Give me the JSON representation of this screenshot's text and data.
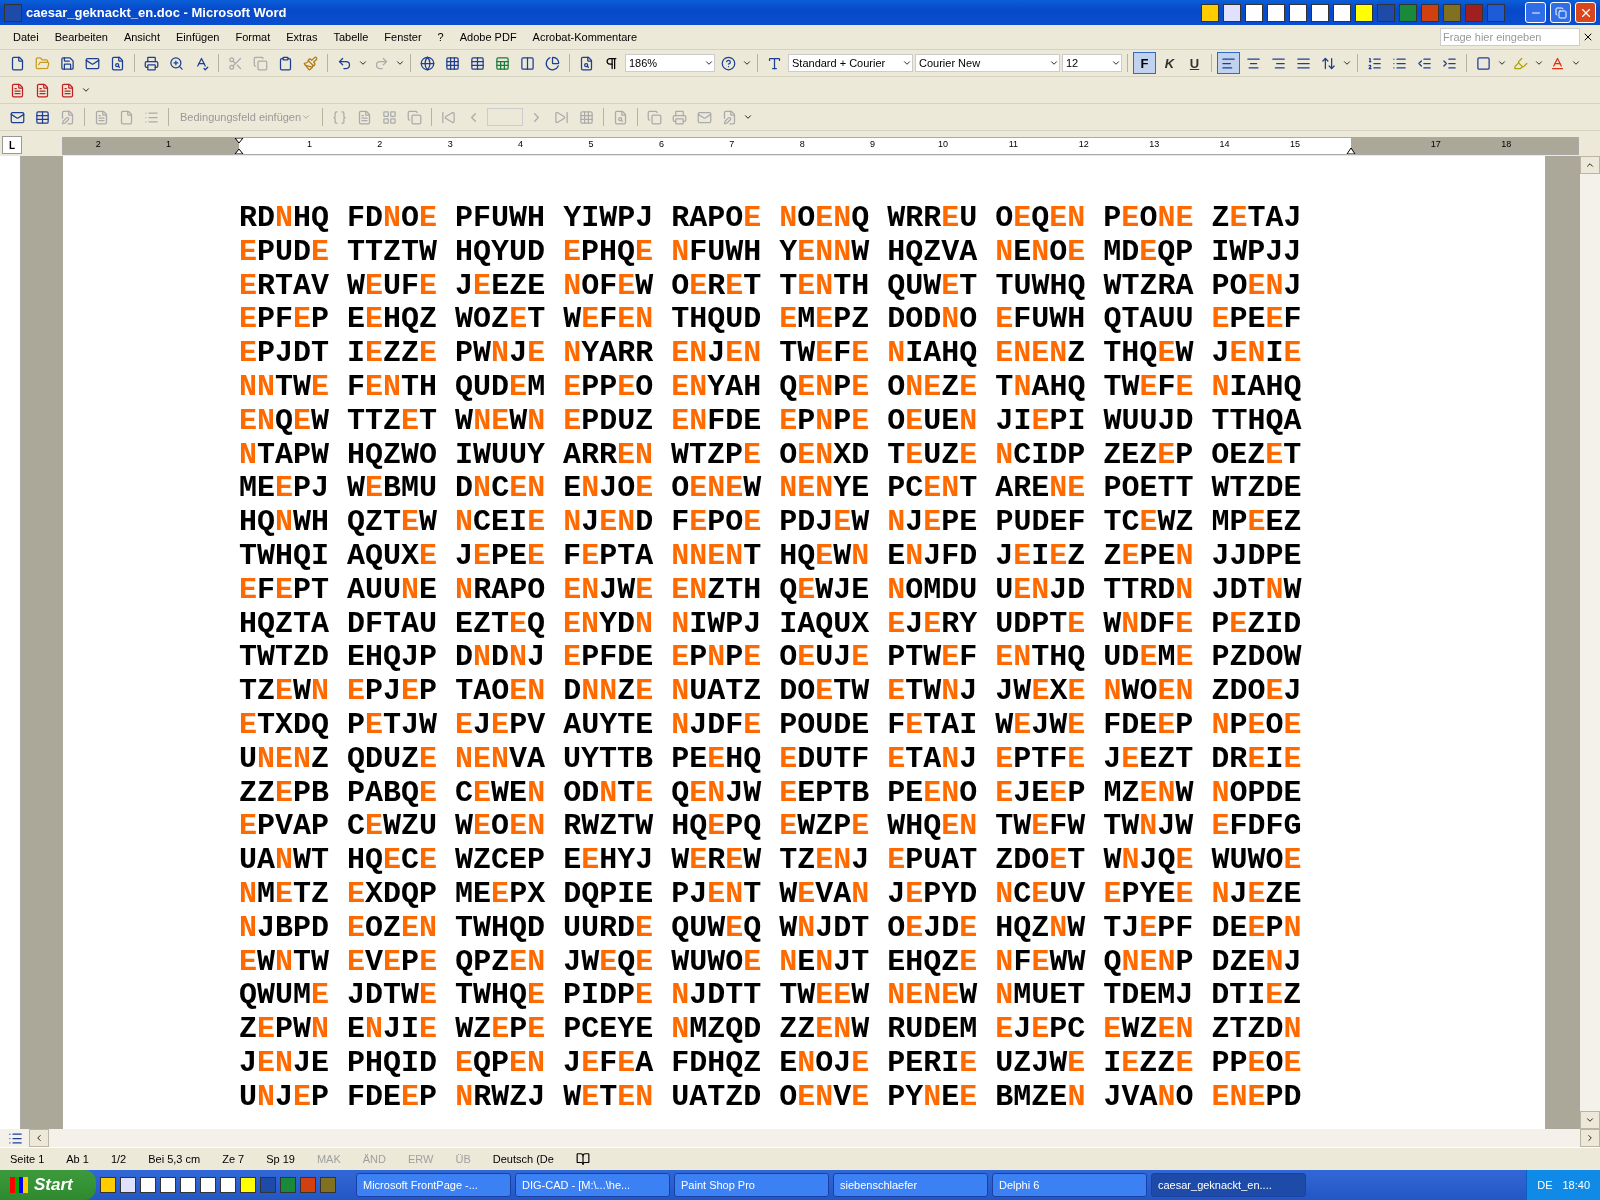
{
  "window": {
    "title": "caesar_geknackt_en.doc - Microsoft Word"
  },
  "menu": [
    "Datei",
    "Bearbeiten",
    "Ansicht",
    "Einfügen",
    "Format",
    "Extras",
    "Tabelle",
    "Fenster",
    "?",
    "Adobe PDF",
    "Acrobat-Kommentare"
  ],
  "help_box": {
    "placeholder": "Frage hier eingeben"
  },
  "formatting": {
    "zoom": "186%",
    "style": "Standard + Courier",
    "font": "Courier New",
    "size": "12",
    "bold": {
      "label": "F",
      "selected": true
    },
    "italic": {
      "label": "K",
      "selected": false
    },
    "underline": {
      "label": "U",
      "selected": false
    },
    "align_left_selected": true
  },
  "mail_merge": {
    "field_button": {
      "label": "Bedingungsfeld einfügen",
      "disabled": true
    }
  },
  "ruler": {
    "tab_selector": "L",
    "left_numbers": [
      "2",
      "1"
    ],
    "numbers": [
      "1",
      "2",
      "3",
      "4",
      "5",
      "6",
      "7",
      "8",
      "9",
      "10",
      "11",
      "12",
      "13",
      "14",
      "15",
      "17",
      "18"
    ]
  },
  "document": {
    "lines": [
      [
        "RD**N**HQ",
        "FD**N**O**E**",
        "PFUWH",
        "YIWPJ",
        "RAPO**E**",
        "**N**O**EN**Q",
        "WRR**E**U",
        "O**E**Q**EN**",
        "P**E**O**NE**",
        "Z**E**TAJ"
      ],
      [
        "**E**PUD**E**",
        "TTZTW",
        "HQYUD",
        "**E**PHQ**E**",
        "**N**FUWH",
        "Y**ENN**W",
        "HQZVA",
        "**N**E**N**O**E**",
        "MD**E**QP",
        "IWPJJ"
      ],
      [
        "**E**RTAV",
        "W**E**UF**E**",
        "J**E**EZE",
        "**N**OF**E**W",
        "O**E**R**E**T",
        "T**EN**TH",
        "QUW**E**T",
        "TUWHQ",
        "WTZRA",
        "PO**EN**J"
      ],
      [
        "**E**PF**E**P",
        "E**E**HQZ",
        "WOZ**E**T",
        "W**E**F**EN**",
        "THQUD",
        "**E**M**E**PZ",
        "DOD**N**O",
        "**E**FUWH",
        "QTAUU",
        "**E**PE**E**F"
      ],
      [
        "**E**PJDT",
        "I**E**ZZ**E**",
        "PW**N**J**E**",
        "**N**YARR",
        "**EN**J**EN**",
        "TW**E**F**E**",
        "**N**IAHQ",
        "**ENEN**Z",
        "THQ**E**W",
        "J**EN**I**E**"
      ],
      [
        "**NN**TW**E**",
        "F**EN**TH",
        "QUD**E**M",
        "**E**PP**E**O",
        "**EN**YAH",
        "Q**EN**P**E**",
        "O**NE**Z**E**",
        "T**N**AHQ",
        "TW**E**F**E**",
        "**N**IAHQ"
      ],
      [
        "**EN**Q**E**W",
        "TTZ**E**T",
        "W**NE**W**N**",
        "**E**PDUZ",
        "**EN**FDE",
        "**E**P**N**P**E**",
        "O**E**UE**N**",
        "JI**E**PI",
        "WUUJD",
        "TTHQA"
      ],
      [
        "**N**TAPW",
        "HQZWO",
        "IWUUY",
        "ARR**EN**",
        "WTZP**E**",
        "O**EN**XD",
        "T**E**UZ**E**",
        "**N**CIDP",
        "ZEZ**E**P",
        "OEZ**E**T"
      ],
      [
        "ME**E**PJ",
        "W**E**BMU",
        "D**N**C**EN**",
        "E**N**JO**E**",
        "O**ENE**W",
        "**NEN**YE",
        "PC**EN**T",
        "ARE**NE**",
        "POETT",
        "WTZDE"
      ],
      [
        "HQ**N**WH",
        "QZT**E**W",
        "**N**CEI**E**",
        "**N**J**EN**D",
        "F**E**PO**E**",
        "PDJ**E**W",
        "**N**J**E**PE",
        "PUDEF",
        "TC**E**WZ",
        "MP**E**EZ"
      ],
      [
        "TWHQI",
        "AQUX**E**",
        "J**E**PE**E**",
        "F**E**PTA",
        "**NNEN**T",
        "HQ**E**W**N**",
        "E**N**JFD",
        "J**E**I**E**Z",
        "Z**E**PE**N**",
        "JJDPE"
      ],
      [
        "**E**F**E**PT",
        "AUU**N**E",
        "**N**RAPO",
        "**EN**JW**E**",
        "**EN**ZTH",
        "Q**E**WJE",
        "**N**OMDU",
        "U**EN**JD",
        "TTRD**N**",
        "JDT**N**W"
      ],
      [
        "HQZTA",
        "DFTAU",
        "EZT**E**Q",
        "**EN**YD**N**",
        "**N**IWPJ",
        "IAQUX",
        "**E**J**E**RY",
        "UDPT**E**",
        "W**N**DF**E**",
        "P**E**ZID"
      ],
      [
        "TWTZD",
        "EHQJP",
        "D**N**D**N**J",
        "**E**PFDE",
        "**E**P**N**P**E**",
        "O**E**UJ**E**",
        "PTW**E**F",
        "**EN**THQ",
        "UD**E**M**E**",
        "PZDOW"
      ],
      [
        "TZ**E**W**N**",
        "**E**PJ**E**P",
        "TAO**EN**",
        "D**NN**Z**E**",
        "**N**UATZ",
        "DO**E**TW",
        "**E**TW**N**J",
        "JW**E**X**E**",
        "**N**WO**EN**",
        "ZDO**E**J"
      ],
      [
        "**E**TXDQ",
        "P**E**TJW",
        "**E**J**E**PV",
        "AUYTE",
        "**N**JDF**E**",
        "POUDE",
        "F**E**TAI",
        "W**E**JW**E**",
        "FDE**E**P",
        "**N**P**E**O**E**"
      ],
      [
        "U**NEN**Z",
        "QDUZ**E**",
        "**NEN**VA",
        "UYTTB",
        "PE**E**HQ",
        "**E**DUTF",
        "**E**TA**N**J",
        "**E**PTF**E**",
        "J**E**EZT",
        "DR**E**I**E**"
      ],
      [
        "ZZ**E**PB",
        "PABQ**E**",
        "C**E**WE**N**",
        "OD**N**T**E**",
        "Q**EN**JW",
        "**E**EPTB",
        "PE**EN**O",
        "**E**JE**E**P",
        "MZ**EN**W",
        "**N**OPDE"
      ],
      [
        "**E**PVAP",
        "C**E**WZU",
        "W**E**O**EN**",
        "RWZTW",
        "HQ**E**PQ",
        "**E**WZP**E**",
        "WHQ**EN**",
        "TW**E**FW",
        "TW**N**JW",
        "**E**FDFG"
      ],
      [
        "UA**N**WT",
        "HQ**E**C**E**",
        "WZCEP",
        "E**E**HYJ",
        "W**E**R**E**W",
        "TZ**EN**J",
        "**E**PUAT",
        "ZDO**E**T",
        "W**N**JQ**E**",
        "WUWO**E**"
      ],
      [
        "**N**M**E**TZ",
        "**E**XDQP",
        "ME**E**PX",
        "DQPIE",
        "PJ**EN**T",
        "W**E**VA**N**",
        "J**E**PYD",
        "**N**C**E**UV",
        "**E**PYE**E**",
        "**N**J**E**ZE"
      ],
      [
        "**N**JBPD",
        "**E**OZ**EN**",
        "TWHQD",
        "UURD**E**",
        "QUW**E**Q",
        "W**N**JDT",
        "O**E**JD**E**",
        "HQZ**N**W",
        "TJ**E**PF",
        "DE**E**P**N**"
      ],
      [
        "**E**W**N**TW",
        "**E**V**E**P**E**",
        "QPZ**EN**",
        "JW**E**Q**E**",
        "WUWO**E**",
        "**N**E**N**JT",
        "EHQZ**E**",
        "**N**F**E**WW",
        "Q**NEN**P",
        "DZE**N**J"
      ],
      [
        "QWUM**E**",
        "JDTW**E**",
        "TWHQ**E**",
        "PIDP**E**",
        "**N**JDTT",
        "TW**EE**W",
        "**NENE**W",
        "**N**MUET",
        "TDEMJ",
        "DTI**E**Z"
      ],
      [
        "Z**E**PW**N**",
        "E**N**JI**E**",
        "WZ**E**P**E**",
        "PCEYE",
        "**N**MZQD",
        "ZZ**EN**W",
        "RUDEM",
        "**E**J**E**PC",
        "**E**WZ**EN**",
        "ZTZD**N**"
      ],
      [
        "J**EN**JE",
        "PHQID",
        "**E**QP**EN**",
        "J**E**F**E**A",
        "FDHQZ",
        "E**N**OJ**E**",
        "PERI**E**",
        "UZJW**E**",
        "I**E**ZZ**E**",
        "PP**E**O**E**"
      ],
      [
        "U**N**J**E**P",
        "FDE**E**P",
        "**N**RWZJ",
        "W**E**T**EN**",
        "UATZD",
        "O**EN**V**E**",
        "PY**N**E**E**",
        "BMZE**N**",
        "JVA**N**O",
        "**ENE**PD"
      ]
    ]
  },
  "status_bar": [
    {
      "text": "Seite 1",
      "disabled": false
    },
    {
      "text": "Ab 1",
      "disabled": false
    },
    {
      "text": "1/2",
      "disabled": false
    },
    {
      "text": "Bei 5,3 cm",
      "disabled": false
    },
    {
      "text": "Ze 7",
      "disabled": false
    },
    {
      "text": "Sp 19",
      "disabled": false
    },
    {
      "text": "MAK",
      "disabled": true
    },
    {
      "text": "ÄND",
      "disabled": true
    },
    {
      "text": "ERW",
      "disabled": true
    },
    {
      "text": "ÜB",
      "disabled": true
    },
    {
      "text": "Deutsch (De",
      "disabled": false
    }
  ],
  "taskbar": {
    "start": "Start",
    "tasks": [
      {
        "label": "Microsoft FrontPage -...",
        "selected": false
      },
      {
        "label": "DIG-CAD - [M:\\...\\he...",
        "selected": false
      },
      {
        "label": "Paint Shop Pro",
        "selected": false
      },
      {
        "label": "siebenschlaefer",
        "selected": false
      },
      {
        "label": "Delphi 6",
        "selected": false
      },
      {
        "label": "caesar_geknackt_en....",
        "selected": true
      }
    ],
    "language": "DE",
    "clock": "18:40"
  }
}
